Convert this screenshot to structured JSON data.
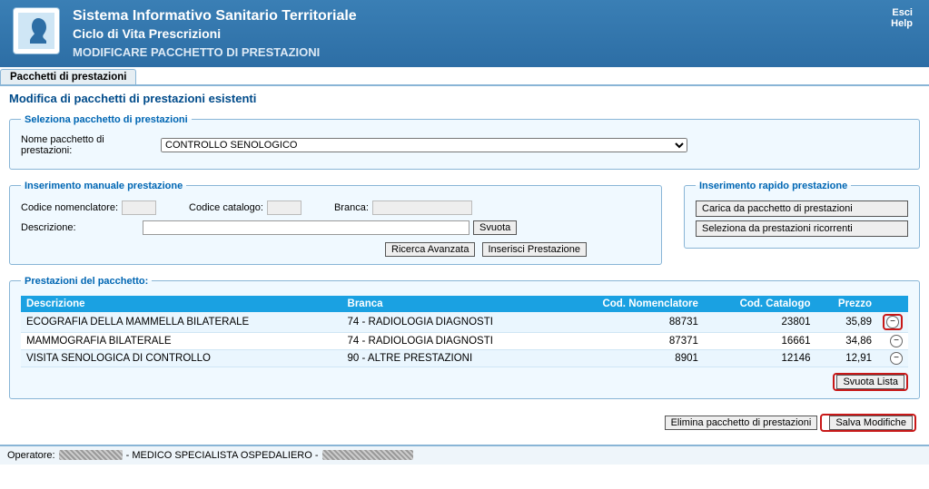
{
  "header": {
    "title_main": "Sistema Informativo Sanitario Territoriale",
    "title_sub": "Ciclo di Vita Prescrizioni",
    "title_action": "MODIFICARE PACCHETTO DI PRESTAZIONI",
    "links": {
      "esci": "Esci",
      "help": "Help"
    }
  },
  "tabbar": {
    "active": "Pacchetti di prestazioni"
  },
  "page_title": "Modifica di pacchetti di prestazioni esistenti",
  "groups": {
    "select_package": {
      "legend": "Seleziona pacchetto di prestazioni",
      "name_label": "Nome pacchetto di prestazioni:",
      "selected": "CONTROLLO SENOLOGICO"
    },
    "manual_insert": {
      "legend": "Inserimento manuale prestazione",
      "codice_nomenclatore_label": "Codice nomenclatore:",
      "codice_catalogo_label": "Codice catalogo:",
      "branca_label": "Branca:",
      "descrizione_label": "Descrizione:",
      "svuota_btn": "Svuota",
      "ricerca_avanzata_btn": "Ricerca Avanzata",
      "inserisci_btn": "Inserisci Prestazione",
      "values": {
        "codice_nomenclatore": "",
        "codice_catalogo": "",
        "branca": "",
        "descrizione": ""
      }
    },
    "quick_insert": {
      "legend": "Inserimento rapido prestazione",
      "carica_btn": "Carica da pacchetto di prestazioni",
      "seleziona_btn": "Seleziona da prestazioni ricorrenti"
    },
    "package_items": {
      "legend": "Prestazioni del pacchetto:",
      "headers": {
        "descrizione": "Descrizione",
        "branca": "Branca",
        "cod_nomenclatore": "Cod. Nomenclatore",
        "cod_catalogo": "Cod. Catalogo",
        "prezzo": "Prezzo"
      },
      "rows": [
        {
          "descrizione": "ECOGRAFIA DELLA MAMMELLA BILATERALE",
          "branca": "74 - RADIOLOGIA DIAGNOSTI",
          "cod_nomenclatore": "88731",
          "cod_catalogo": "23801",
          "prezzo": "35,89"
        },
        {
          "descrizione": "MAMMOGRAFIA BILATERALE",
          "branca": "74 - RADIOLOGIA DIAGNOSTI",
          "cod_nomenclatore": "87371",
          "cod_catalogo": "16661",
          "prezzo": "34,86"
        },
        {
          "descrizione": "VISITA SENOLOGICA DI CONTROLLO",
          "branca": "90 - ALTRE PRESTAZIONI",
          "cod_nomenclatore": "8901",
          "cod_catalogo": "12146",
          "prezzo": "12,91"
        }
      ],
      "svuota_lista_btn": "Svuota Lista"
    }
  },
  "footer_actions": {
    "elimina_btn": "Elimina pacchetto di prestazioni",
    "salva_btn": "Salva Modifiche"
  },
  "statusbar": {
    "operatore_label": "Operatore:",
    "role": " - MEDICO SPECIALISTA OSPEDALIERO - "
  }
}
